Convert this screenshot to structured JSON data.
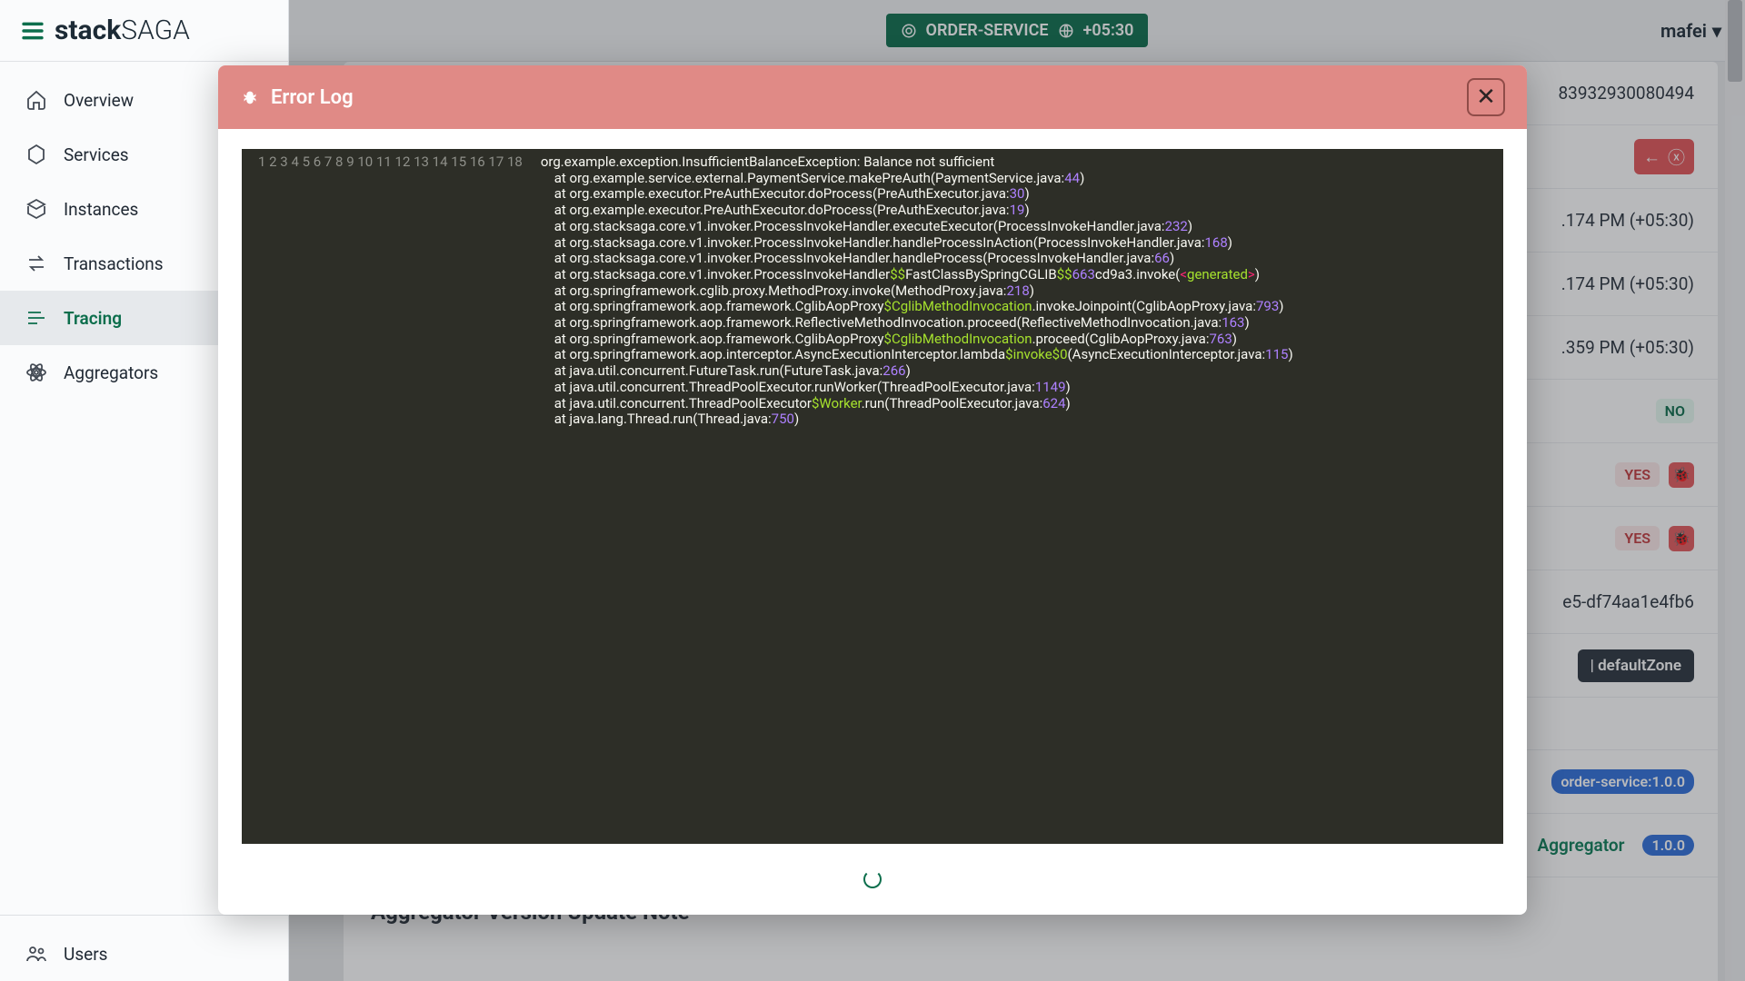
{
  "brand": {
    "part1": "stack",
    "part2": "SAGA"
  },
  "header": {
    "service": "ORDER-SERVICE",
    "tz": "+05:30",
    "user": "mafei"
  },
  "sidebar": {
    "items": [
      {
        "label": "Overview"
      },
      {
        "label": "Services"
      },
      {
        "label": "Instances"
      },
      {
        "label": "Transactions"
      },
      {
        "label": "Tracing"
      },
      {
        "label": "Aggregators"
      }
    ],
    "bottom": {
      "label": "Users"
    }
  },
  "background": {
    "id_tail": "83932930080494",
    "ts1": ".174 PM (+05:30)",
    "ts2": ".174 PM (+05:30)",
    "ts3": ".359 PM (+05:30)",
    "no": "NO",
    "yes": "YES",
    "uuid_tail": "e5-df74aa1e4fb6",
    "zone": " | defaultZone",
    "svc_ver": "order-service:1.0.0",
    "aggr": "Aggregator",
    "aggr_ver": "1.0.0",
    "section_title": "Aggregator Version Update Note"
  },
  "modal": {
    "title": "Error Log",
    "lines": 18,
    "code_rows": [
      [
        {
          "t": "org.example.exception.InsufficientBalanceException: Balance not sufficient",
          "c": ""
        }
      ],
      [
        {
          "t": "    at org.example.service.external.PaymentService.makePreAuth(PaymentService.java:",
          "c": ""
        },
        {
          "t": "44",
          "c": "tok-num"
        },
        {
          "t": ")",
          "c": ""
        }
      ],
      [
        {
          "t": "    at org.example.executor.PreAuthExecutor.doProcess(PreAuthExecutor.java:",
          "c": ""
        },
        {
          "t": "30",
          "c": "tok-num"
        },
        {
          "t": ")",
          "c": ""
        }
      ],
      [
        {
          "t": "    at org.example.executor.PreAuthExecutor.doProcess(PreAuthExecutor.java:",
          "c": ""
        },
        {
          "t": "19",
          "c": "tok-num"
        },
        {
          "t": ")",
          "c": ""
        }
      ],
      [
        {
          "t": "    at org.stacksaga.core.v1.invoker.ProcessInvokeHandler.executeExecutor(ProcessInvokeHandler.java:",
          "c": ""
        },
        {
          "t": "232",
          "c": "tok-num"
        },
        {
          "t": ")",
          "c": ""
        }
      ],
      [
        {
          "t": "    at org.stacksaga.core.v1.invoker.ProcessInvokeHandler.handleProcessInAction(ProcessInvokeHandler.java:",
          "c": ""
        },
        {
          "t": "168",
          "c": "tok-num"
        },
        {
          "t": ")",
          "c": ""
        }
      ],
      [
        {
          "t": "    at org.stacksaga.core.v1.invoker.ProcessInvokeHandler.handleProcess(ProcessInvokeHandler.java:",
          "c": ""
        },
        {
          "t": "66",
          "c": "tok-num"
        },
        {
          "t": ")",
          "c": ""
        }
      ],
      [
        {
          "t": "    at org.stacksaga.core.v1.invoker.ProcessInvokeHandler",
          "c": ""
        },
        {
          "t": "$$",
          "c": "tok-str"
        },
        {
          "t": "FastClassBySpringCGLIB",
          "c": ""
        },
        {
          "t": "$$",
          "c": "tok-str"
        },
        {
          "t": "663",
          "c": "tok-num"
        },
        {
          "t": "cd9a3.invoke(",
          "c": ""
        },
        {
          "t": "<",
          "c": "tok-sym"
        },
        {
          "t": "generated",
          "c": "tok-str"
        },
        {
          "t": ">",
          "c": "tok-sym"
        },
        {
          "t": ")",
          "c": ""
        }
      ],
      [
        {
          "t": "    at org.springframework.cglib.proxy.MethodProxy.invoke(MethodProxy.java:",
          "c": ""
        },
        {
          "t": "218",
          "c": "tok-num"
        },
        {
          "t": ")",
          "c": ""
        }
      ],
      [
        {
          "t": "    at org.springframework.aop.framework.CglibAopProxy",
          "c": ""
        },
        {
          "t": "$CglibMethodInvocation",
          "c": "tok-str"
        },
        {
          "t": ".invokeJoinpoint(CglibAopProxy.java:",
          "c": ""
        },
        {
          "t": "793",
          "c": "tok-num"
        },
        {
          "t": ")",
          "c": ""
        }
      ],
      [
        {
          "t": "    at org.springframework.aop.framework.ReflectiveMethodInvocation.proceed(ReflectiveMethodInvocation.java:",
          "c": ""
        },
        {
          "t": "163",
          "c": "tok-num"
        },
        {
          "t": ")",
          "c": ""
        }
      ],
      [
        {
          "t": "    at org.springframework.aop.framework.CglibAopProxy",
          "c": ""
        },
        {
          "t": "$CglibMethodInvocation",
          "c": "tok-str"
        },
        {
          "t": ".proceed(CglibAopProxy.java:",
          "c": ""
        },
        {
          "t": "763",
          "c": "tok-num"
        },
        {
          "t": ")",
          "c": ""
        }
      ],
      [
        {
          "t": "    at org.springframework.aop.interceptor.AsyncExecutionInterceptor.lambda",
          "c": ""
        },
        {
          "t": "$invoke",
          "c": "tok-str"
        },
        {
          "t": "$0",
          "c": "tok-str"
        },
        {
          "t": "(AsyncExecutionInterceptor.java:",
          "c": ""
        },
        {
          "t": "115",
          "c": "tok-num"
        },
        {
          "t": ")",
          "c": ""
        }
      ],
      [
        {
          "t": "    at java.util.concurrent.FutureTask.run(FutureTask.java:",
          "c": ""
        },
        {
          "t": "266",
          "c": "tok-num"
        },
        {
          "t": ")",
          "c": ""
        }
      ],
      [
        {
          "t": "    at java.util.concurrent.ThreadPoolExecutor.runWorker(ThreadPoolExecutor.java:",
          "c": ""
        },
        {
          "t": "1149",
          "c": "tok-num"
        },
        {
          "t": ")",
          "c": ""
        }
      ],
      [
        {
          "t": "    at java.util.concurrent.ThreadPoolExecutor",
          "c": ""
        },
        {
          "t": "$Worker",
          "c": "tok-str"
        },
        {
          "t": ".run(ThreadPoolExecutor.java:",
          "c": ""
        },
        {
          "t": "624",
          "c": "tok-num"
        },
        {
          "t": ")",
          "c": ""
        }
      ],
      [
        {
          "t": "    at java.lang.Thread.run(Thread.java:",
          "c": ""
        },
        {
          "t": "750",
          "c": "tok-num"
        },
        {
          "t": ")",
          "c": ""
        }
      ],
      [
        {
          "t": "",
          "c": ""
        }
      ]
    ]
  }
}
